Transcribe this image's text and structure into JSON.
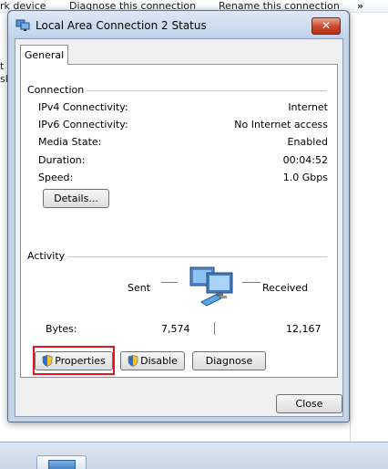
{
  "background": {
    "toolbar_items": [
      "rk device",
      "Diagnose this connection",
      "Rename this connection",
      "»"
    ],
    "left_fragments": [
      "t",
      "sk"
    ]
  },
  "dialog": {
    "title": "Local Area Connection 2 Status",
    "close_glyph": "✕",
    "tab": "General",
    "connection": {
      "heading": "Connection",
      "rows": [
        {
          "label": "IPv4 Connectivity:",
          "value": "Internet"
        },
        {
          "label": "IPv6 Connectivity:",
          "value": "No Internet access"
        },
        {
          "label": "Media State:",
          "value": "Enabled"
        },
        {
          "label": "Duration:",
          "value": "00:04:52"
        },
        {
          "label": "Speed:",
          "value": "1.0 Gbps"
        }
      ],
      "details_button": "Details..."
    },
    "activity": {
      "heading": "Activity",
      "sent_label": "Sent",
      "received_label": "Received",
      "bytes_label": "Bytes:",
      "bytes_sent": "7,574",
      "bytes_received": "12,167"
    },
    "buttons": {
      "properties": "Properties",
      "disable": "Disable",
      "diagnose": "Diagnose",
      "close": "Close"
    }
  },
  "colors": {
    "highlight": "#e3141c",
    "close_button": "#c8472b"
  }
}
